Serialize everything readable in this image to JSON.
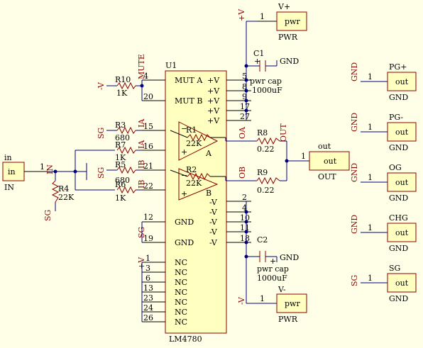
{
  "colors": {
    "background": "#ffffe8",
    "wire": "#000080",
    "part": "#8b0000",
    "body": "#ffffc0"
  },
  "ic": {
    "ref": "U1",
    "name": "LM4780",
    "pins_left": [
      {
        "num": "4",
        "label": "MUT A"
      },
      {
        "num": "20",
        "label": "MUT B"
      },
      {
        "num": "15",
        "label": ""
      },
      {
        "num": "16",
        "label": ""
      },
      {
        "num": "21",
        "label": ""
      },
      {
        "num": "22",
        "label": ""
      },
      {
        "num": "12",
        "label": "GND"
      },
      {
        "num": "19",
        "label": "GND"
      },
      {
        "num": "1",
        "label": "NC"
      },
      {
        "num": "3",
        "label": "NC"
      },
      {
        "num": "6",
        "label": "NC"
      },
      {
        "num": "13",
        "label": "NC"
      },
      {
        "num": "23",
        "label": "NC"
      },
      {
        "num": "24",
        "label": "NC"
      },
      {
        "num": "26",
        "label": "NC"
      }
    ],
    "pins_right": [
      {
        "num": "5",
        "label": "+V"
      },
      {
        "num": "8",
        "label": "+V"
      },
      {
        "num": "9",
        "label": "+V"
      },
      {
        "num": "17",
        "label": "+V"
      },
      {
        "num": "27",
        "label": "+V"
      },
      {
        "num": "2",
        "label": "-V"
      },
      {
        "num": "4",
        "label": "-V"
      },
      {
        "num": "10",
        "label": "-V"
      },
      {
        "num": "11",
        "label": "-V"
      },
      {
        "num": "18",
        "label": "-V"
      }
    ],
    "amp_a": {
      "r": "R1",
      "rval": "22K",
      "label": "A"
    },
    "amp_b": {
      "r": "R2",
      "rval": "22K",
      "label": "B"
    }
  },
  "resistors": {
    "r10": {
      "ref": "R10",
      "val": "1K"
    },
    "r3": {
      "ref": "R3",
      "val": "680"
    },
    "r7": {
      "ref": "R7",
      "val": "1K"
    },
    "r5": {
      "ref": "R5",
      "val": "680"
    },
    "r6": {
      "ref": "R6",
      "val": "1K"
    },
    "r4": {
      "ref": "R4",
      "val": "22K"
    },
    "r8": {
      "ref": "R8",
      "val": "0.22"
    },
    "r9": {
      "ref": "R9",
      "val": "0.22"
    }
  },
  "caps": {
    "c1": {
      "ref": "C1",
      "name": "pwr cap",
      "val": "1000uF",
      "gnd": "GND"
    },
    "c2": {
      "ref": "C2",
      "name": "pwr cap",
      "val": "1000uF",
      "gnd": "GND"
    }
  },
  "nets": {
    "mute": "MUTE",
    "neg_v": "-V",
    "pos_v": "+V",
    "sg": "SG",
    "ia": "IA",
    "ib": "IB",
    "oa": "OA",
    "ob": "OB",
    "in": "IN",
    "out": "OUT",
    "gnd": "GND",
    "pg_plus": "PG+",
    "pg_minus": "PG-",
    "og": "OG",
    "chg": "CHG"
  },
  "ports": {
    "in": {
      "top": "in",
      "body": "in",
      "bottom": "IN",
      "pin": "1"
    },
    "out": {
      "top": "out",
      "body": "out",
      "bottom": "OUT",
      "pin": "1"
    },
    "vplus": {
      "top": "V+",
      "body": "pwr",
      "bottom": "PWR",
      "pin": "1"
    },
    "vminus": {
      "top": "V-",
      "body": "pwr",
      "bottom": "PWR",
      "pin": "1"
    },
    "pg_plus": {
      "top": "PG+",
      "body": "out",
      "bottom": "GND",
      "pin": "1"
    },
    "pg_minus": {
      "top": "PG-",
      "body": "out",
      "bottom": "GND",
      "pin": "1"
    },
    "og": {
      "top": "OG",
      "body": "out",
      "bottom": "GND",
      "pin": "1"
    },
    "chg": {
      "top": "CHG",
      "body": "out",
      "bottom": "GND",
      "pin": "1"
    },
    "sg": {
      "top": "SG",
      "body": "out",
      "bottom": "GND",
      "pin": "1"
    }
  }
}
